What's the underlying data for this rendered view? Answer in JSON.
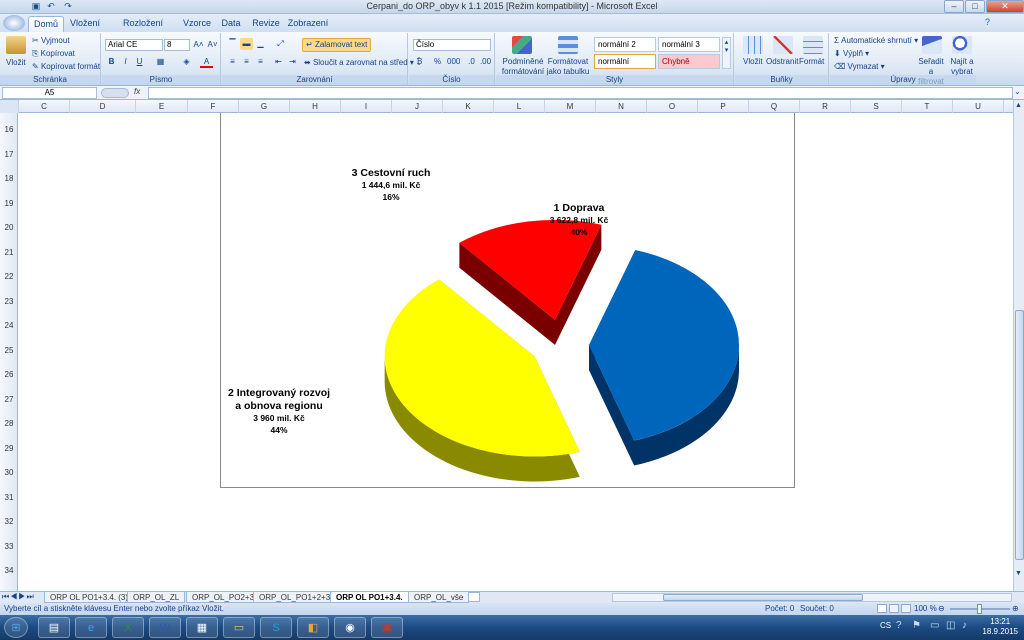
{
  "window": {
    "title": "Cerpani_do ORP_obyv k 1.1 2015 [Režim kompatibility] - Microsoft Excel",
    "minimize": "–",
    "maximize": "□",
    "close": "✕"
  },
  "quick_access": [
    "save-icon",
    "undo-icon",
    "redo-icon"
  ],
  "ribbon_tabs": [
    "Domů",
    "Vložení",
    "Rozložení stránky",
    "Vzorce",
    "Data",
    "Revize",
    "Zobrazení"
  ],
  "ribbon": {
    "clipboard": {
      "paste": "Vložit",
      "cut": "Vyjmout",
      "copy": "Kopírovat",
      "format_painter": "Kopírovat formát",
      "label": "Schránka"
    },
    "font": {
      "name": "Arial CE",
      "size": "8",
      "label": "Písmo"
    },
    "alignment": {
      "wrap": "Zalamovat text",
      "merge": "Sloučit a zarovnat na střed",
      "label": "Zarovnání"
    },
    "number": {
      "format": "Číslo",
      "label": "Číslo"
    },
    "styles": {
      "conditional": "Podmíněné formátování",
      "format_table": "Formátovat jako tabulku",
      "cells": [
        "normální 2",
        "normální 3",
        "normální",
        "Chybně"
      ],
      "label": "Styly"
    },
    "cells": {
      "insert": "Vložit",
      "delete": "Odstranit",
      "format": "Formát",
      "label": "Buňky"
    },
    "editing": {
      "autosum": "Automatické shrnutí",
      "fill": "Výplň",
      "clear": "Vymazat",
      "sort": "Seřadit a filtrovat",
      "find": "Najít a vybrat",
      "label": "Úpravy"
    }
  },
  "formula_bar": {
    "name_box": "A5",
    "fx": "fx",
    "value": ""
  },
  "columns": [
    "C",
    "D",
    "E",
    "F",
    "G",
    "H",
    "I",
    "J",
    "K",
    "L",
    "M",
    "N",
    "O",
    "P",
    "Q",
    "R",
    "S",
    "T",
    "U"
  ],
  "rows": [
    "16",
    "17",
    "18",
    "19",
    "20",
    "21",
    "22",
    "23",
    "24",
    "25",
    "26",
    "27",
    "28",
    "29",
    "30",
    "31",
    "32",
    "33",
    "34"
  ],
  "chart_data": {
    "type": "pie",
    "title": "",
    "categories": [
      "1 Doprava",
      "2 Integrovaný rozvoj a obnova regionu",
      "3 Cestovní ruch"
    ],
    "values": [
      3622.8,
      3960,
      1444.6
    ],
    "value_labels": [
      "3 622,8 mil. Kč",
      "3 960 mil. Kč",
      "1 444,6 mil. Kč"
    ],
    "percent_labels": [
      "40%",
      "44%",
      "16%"
    ],
    "label_lines": [
      [
        "1 Doprava"
      ],
      [
        "2 Integrovaný rozvoj",
        "a obnova regionu"
      ],
      [
        "3 Cestovní ruch"
      ]
    ],
    "colors": [
      "#0066bb",
      "#ffff00",
      "#ff0000"
    ],
    "side_colors": [
      "#003366",
      "#8a8a00",
      "#7a0000"
    ],
    "legend": "none",
    "three_d": true,
    "exploded": true
  },
  "sheet_tabs": [
    "ORP OL PO1+3.4. (3)",
    "ORP_OL_ZL",
    "ORP_OL_PO2+3",
    "ORP_OL_PO1+2+3",
    "ORP OL PO1+3.4.",
    "ORP_OL_vše"
  ],
  "active_sheet": 4,
  "status": {
    "message": "Vyberte cíl a stiskněte klávesu Enter nebo zvolte příkaz Vložit.",
    "count": "Počet: 0",
    "sum": "Součet: 0",
    "zoom": "100 %"
  },
  "taskbar": {
    "apps": [
      "start-icon",
      "explorer-icon",
      "ie-icon",
      "excel-icon",
      "word-icon",
      "calculator-icon",
      "folder-icon",
      "skype-icon",
      "office-icon",
      "media-icon",
      "pdf-icon"
    ],
    "lang": "CS",
    "time": "13:21",
    "date": "18.9.2015"
  }
}
